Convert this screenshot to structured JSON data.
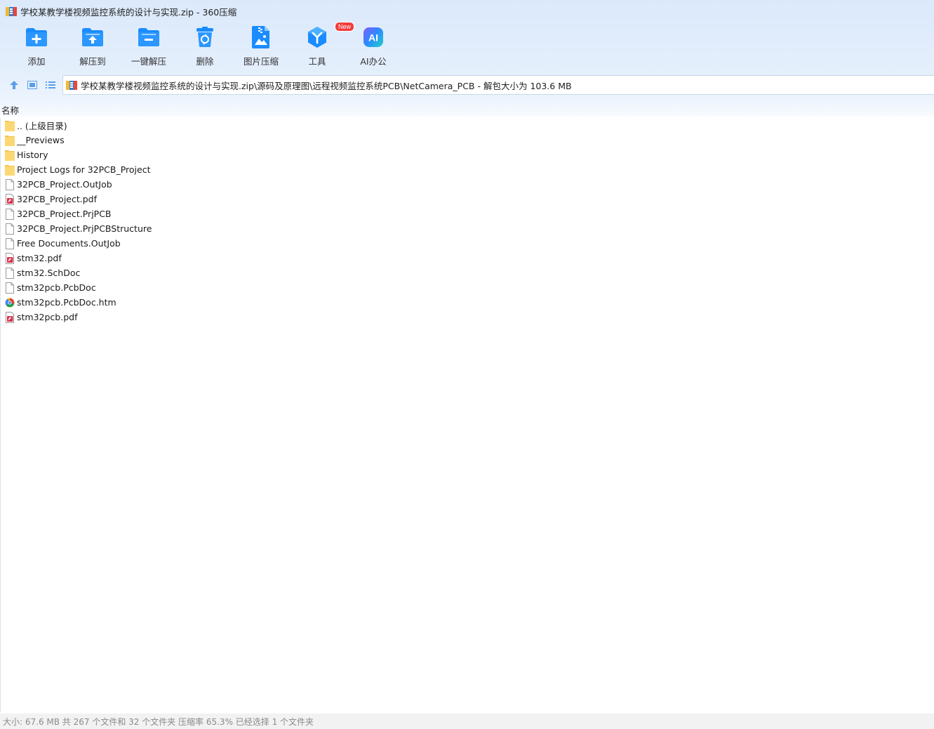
{
  "window": {
    "title": "学校某教学楼视频监控系统的设计与实现.zip - 360压缩"
  },
  "toolbar": {
    "items": [
      {
        "label": "添加",
        "icon": "add-folder-icon"
      },
      {
        "label": "解压到",
        "icon": "extract-to-icon"
      },
      {
        "label": "一键解压",
        "icon": "one-click-extract-icon"
      },
      {
        "label": "删除",
        "icon": "delete-icon"
      },
      {
        "label": "图片压缩",
        "icon": "image-compress-icon"
      },
      {
        "label": "工具",
        "icon": "tools-icon",
        "badge": "New"
      },
      {
        "label": "AI办公",
        "icon": "ai-office-icon",
        "icon_text": "AI"
      }
    ]
  },
  "navigation": {
    "path": "学校某教学楼视频监控系统的设计与实现.zip\\源码及原理图\\远程视频监控系统PCB\\NetCamera_PCB - 解包大小为 103.6 MB"
  },
  "list": {
    "column_name": "名称",
    "files": [
      {
        "name": ".. (上级目录)",
        "type": "folder"
      },
      {
        "name": "__Previews",
        "type": "folder"
      },
      {
        "name": "History",
        "type": "folder"
      },
      {
        "name": "Project Logs for 32PCB_Project",
        "type": "folder"
      },
      {
        "name": "32PCB_Project.OutJob",
        "type": "file"
      },
      {
        "name": "32PCB_Project.pdf",
        "type": "pdf"
      },
      {
        "name": "32PCB_Project.PrjPCB",
        "type": "file"
      },
      {
        "name": "32PCB_Project.PrjPCBStructure",
        "type": "file"
      },
      {
        "name": "Free Documents.OutJob",
        "type": "file"
      },
      {
        "name": "stm32.pdf",
        "type": "pdf"
      },
      {
        "name": "stm32.SchDoc",
        "type": "file"
      },
      {
        "name": "stm32pcb.PcbDoc",
        "type": "file"
      },
      {
        "name": "stm32pcb.PcbDoc.htm",
        "type": "htm"
      },
      {
        "name": "stm32pcb.pdf",
        "type": "pdf"
      }
    ]
  },
  "status": {
    "text": "大小: 67.6 MB 共 267 个文件和 32 个文件夹 压缩率 65.3% 已经选择 1 个文件夹"
  },
  "colors": {
    "accent_blue": "#1a8cff",
    "folder_yellow": "#fcd874",
    "pdf_red": "#e0304a",
    "new_badge": "#f23c3c"
  }
}
